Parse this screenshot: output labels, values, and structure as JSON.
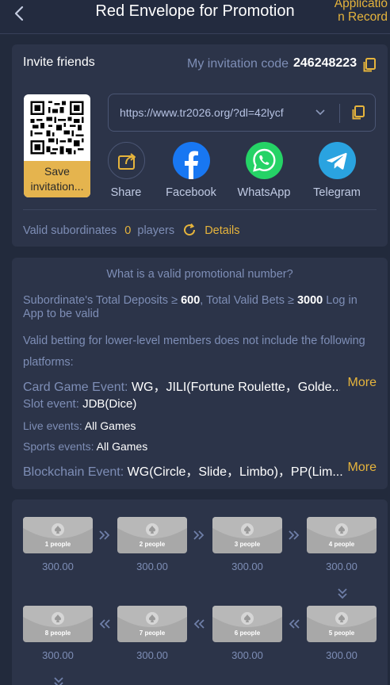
{
  "header": {
    "title": "Red Envelope for Promotion",
    "application_record_line1": "Applicatio",
    "application_record_line2": "n Record"
  },
  "invite": {
    "title": "Invite friends",
    "code_label": "My invitation code",
    "code_value": "246248223",
    "save_line1": "Save",
    "save_line2": "invitation...",
    "url": "https://www.tr2026.org/?dl=42lycf",
    "share_items": [
      {
        "label": "Share",
        "icon": "share-icon",
        "color": "#2c3449"
      },
      {
        "label": "Facebook",
        "icon": "facebook-icon",
        "color": "#1877f2"
      },
      {
        "label": "WhatsApp",
        "icon": "whatsapp-icon",
        "color": "#25d366"
      },
      {
        "label": "Telegram",
        "icon": "telegram-icon",
        "color": "#2aa3e0"
      }
    ],
    "valid_label": "Valid subordinates",
    "valid_count": "0",
    "valid_unit": "players",
    "details_label": "Details"
  },
  "rules": {
    "question": "What is a valid promotional number?",
    "line1_a": "Subordinate's Total Deposits ≥",
    "line1_deposit": "600",
    "line1_b": ",  Total Valid Bets ≥",
    "line1_bets": "3000",
    "line1_c": "Log in",
    "line2": "App to be valid",
    "note_line1": "Valid betting for lower-level members does not include the following",
    "note_line2": "platforms:",
    "rows": [
      {
        "label": "Card Game Event:",
        "value": "WG，JILI(Fortune Roulette，Golde...",
        "more": "More"
      },
      {
        "label": "Slot event:",
        "value": "JDB(Dice)",
        "more": ""
      },
      {
        "label": "Live events:",
        "value": "All Games",
        "more": ""
      },
      {
        "label": "Sports events:",
        "value": "All Games",
        "more": ""
      },
      {
        "label": "Blockchain Event:",
        "value": "WG(Circle，Slide，Limbo)，PP(Lim...",
        "more": "More"
      }
    ]
  },
  "envelopes": [
    {
      "label": "1 people",
      "amount": "300.00"
    },
    {
      "label": "2 people",
      "amount": "300.00"
    },
    {
      "label": "3 people",
      "amount": "300.00"
    },
    {
      "label": "4 people",
      "amount": "300.00"
    },
    {
      "label": "8 people",
      "amount": "300.00"
    },
    {
      "label": "7 people",
      "amount": "300.00"
    },
    {
      "label": "6 people",
      "amount": "300.00"
    },
    {
      "label": "5 people",
      "amount": "300.00"
    }
  ],
  "colors": {
    "background": "#222a3c",
    "card": "#2c3449",
    "accent": "#e6b43c",
    "muted": "#7e8eb6"
  }
}
